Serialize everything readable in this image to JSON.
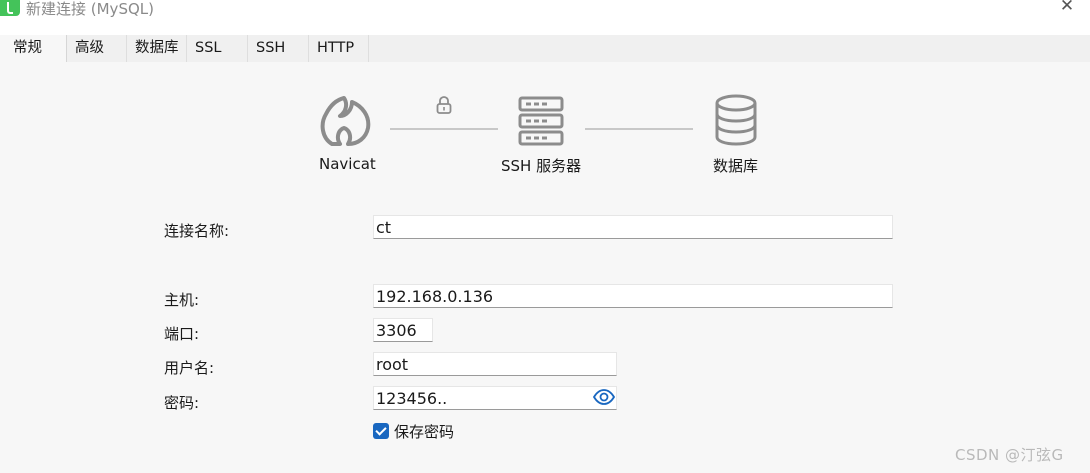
{
  "window": {
    "title": "新建连接 (MySQL)",
    "close_symbol": "✕"
  },
  "tabs": [
    {
      "label": "常规",
      "active": true
    },
    {
      "label": "高级",
      "active": false
    },
    {
      "label": "数据库",
      "active": false
    },
    {
      "label": "SSL",
      "active": false
    },
    {
      "label": "SSH",
      "active": false
    },
    {
      "label": "HTTP",
      "active": false
    }
  ],
  "diagram": {
    "navicat_label": "Navicat",
    "ssh_label": "SSH 服务器",
    "database_label": "数据库",
    "icons": [
      "navicat-logo-icon",
      "lock-icon",
      "server-icon",
      "database-icon"
    ]
  },
  "form": {
    "connection_name": {
      "label": "连接名称:",
      "value": "ct"
    },
    "host": {
      "label": "主机:",
      "value": "192.168.0.136"
    },
    "port": {
      "label": "端口:",
      "value": "3306"
    },
    "username": {
      "label": "用户名:",
      "value": "root"
    },
    "password": {
      "label": "密码:",
      "value": "123456.."
    },
    "save_password": {
      "label": "保存密码",
      "checked": true
    }
  },
  "watermark": "CSDN @汀弦G",
  "colors": {
    "accent": "#1967c0",
    "app_icon": "#44c35a",
    "diagram_gray": "#8c8c8c"
  }
}
